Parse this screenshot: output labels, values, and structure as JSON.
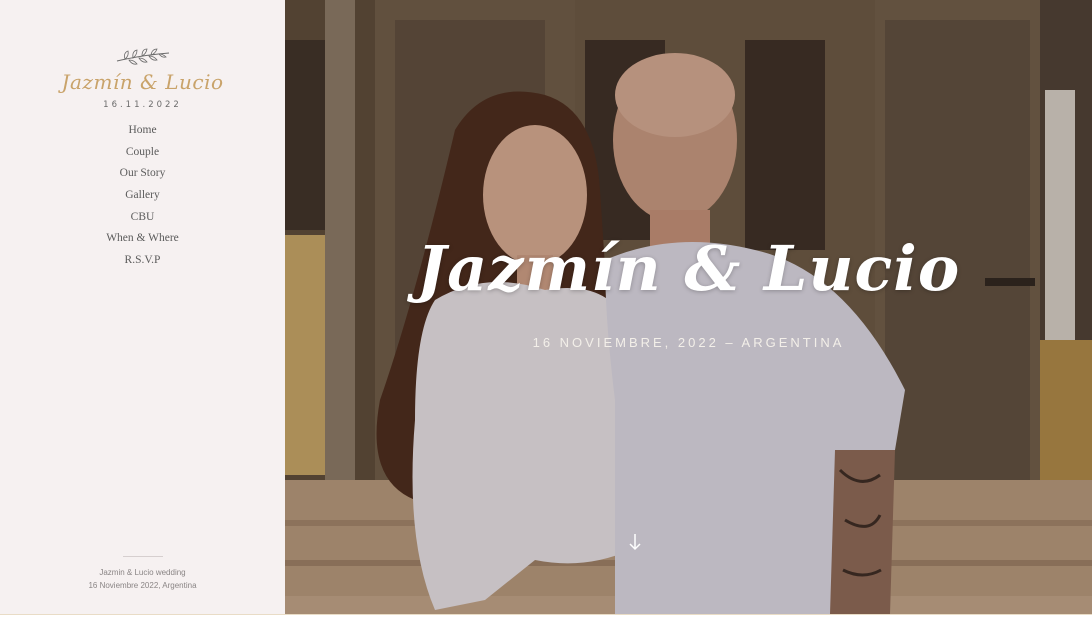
{
  "sidebar": {
    "logo_names": "Jazmín & Lucio",
    "logo_date": "16.11.2022",
    "nav_items": [
      {
        "label": "Home"
      },
      {
        "label": "Couple"
      },
      {
        "label": "Our Story"
      },
      {
        "label": "Gallery"
      },
      {
        "label": "CBU"
      },
      {
        "label": "When & Where"
      },
      {
        "label": "R.S.V.P"
      }
    ],
    "footer": {
      "line1": "Jazmin & Lucio wedding",
      "line2": "16 Noviembre 2022, Argentina"
    }
  },
  "hero": {
    "title": "Jazmín & Lucio",
    "subtitle": "16 NOVIEMBRE, 2022 – ARGENTINA",
    "scroll_icon": "arrow-down-icon"
  },
  "colors": {
    "accent_gold": "#c9a36a",
    "sidebar_bg": "#f6f1f1",
    "nav_text": "#5b5b5b",
    "hero_text": "#ffffff"
  }
}
